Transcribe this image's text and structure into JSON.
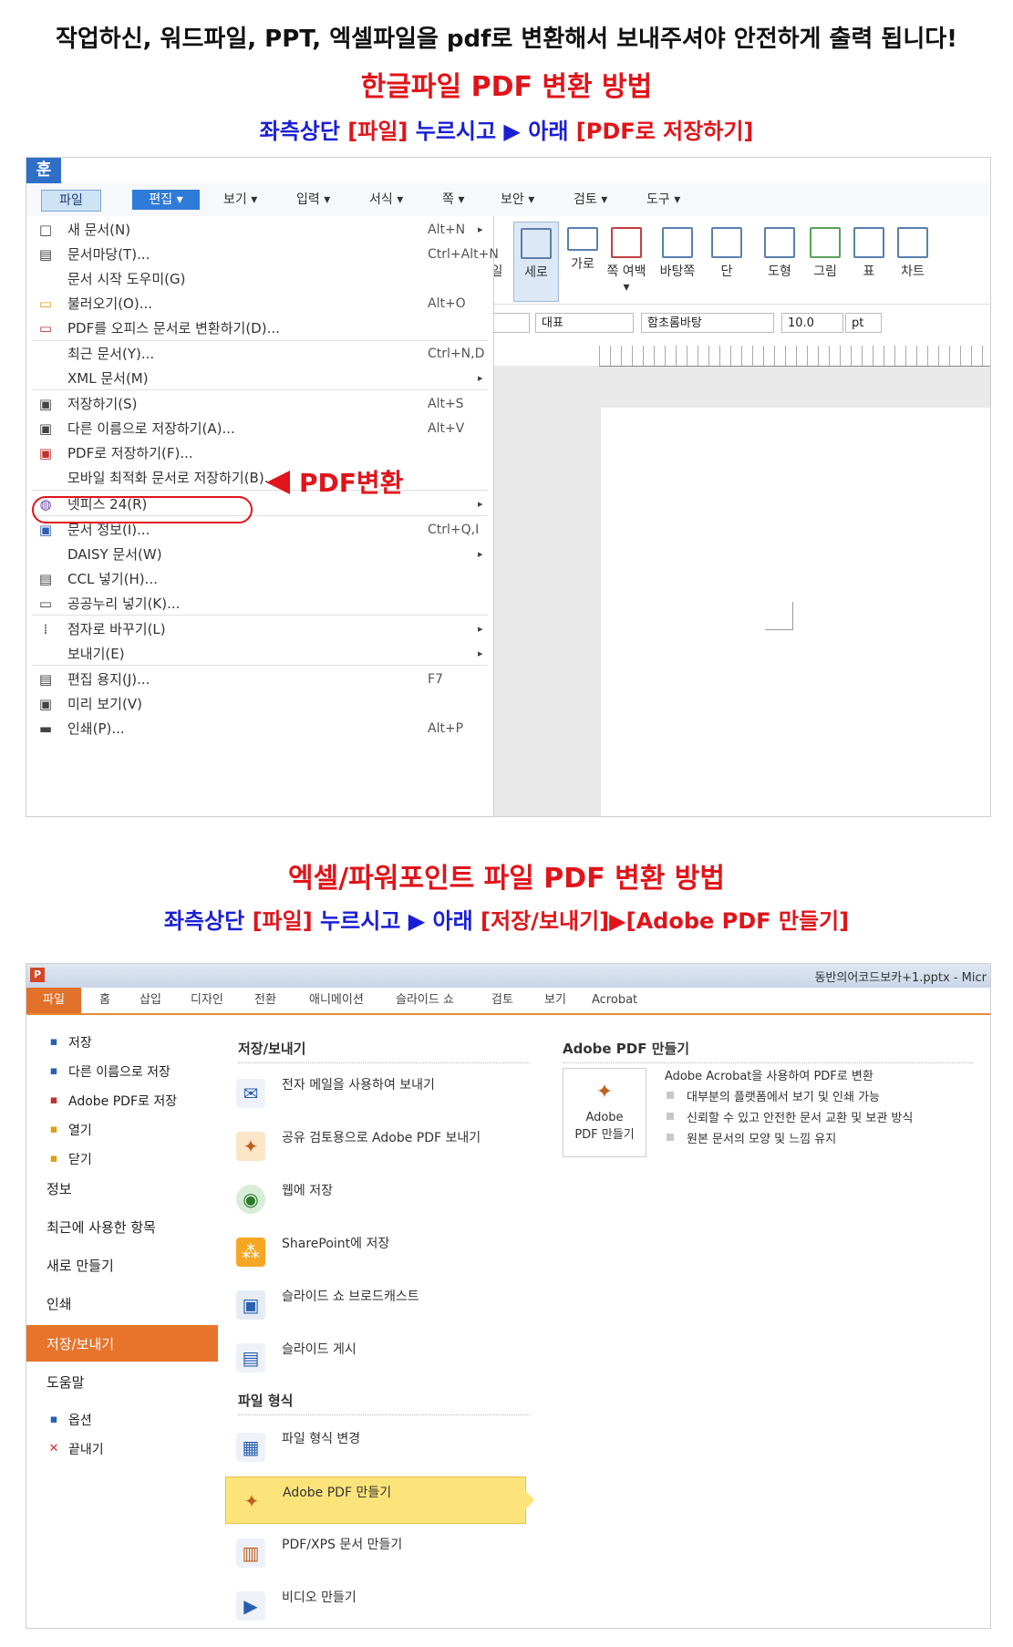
{
  "header": {
    "notice": "작업하신, 워드파일, PPT, 엑셀파일을 pdf로 변환해서 보내주셔야 안전하게 출력 됩니다!",
    "hwp_title": "한글파일 PDF 변환 방법",
    "hwp_instruction_a": "좌측상단 ",
    "hwp_instruction_b": "[파일]",
    "hwp_instruction_c": " 누르시고 ▶ 아래 ",
    "hwp_instruction_d": "[PDF로 저장하기]",
    "ppt_title": "엑셀/파워포인트 파일 PDF 변환 방법",
    "ppt_instruction_a": "좌측상단 ",
    "ppt_instruction_b": "[파일]",
    "ppt_instruction_c": " 누르시고 ▶ 아래 ",
    "ppt_instruction_d": "[저장/보내기]▶[Adobe PDF 만들기]"
  },
  "hwp": {
    "logo": "훈",
    "menu_tabs": [
      "파일",
      "편집 ▾",
      "보기 ▾",
      "입력 ▾",
      "서식 ▾",
      "쪽 ▾",
      "보안 ▾",
      "검토 ▾",
      "도구 ▾"
    ],
    "file_menu": [
      {
        "icon": "□",
        "label": "새 문서(N)",
        "shortcut": "Alt+N",
        "arrow": "▸"
      },
      {
        "icon": "▤",
        "label": "문서마당(T)...",
        "shortcut": "Ctrl+Alt+N",
        "arrow": ""
      },
      {
        "icon": "",
        "label": "문서 시작 도우미(G)",
        "shortcut": "",
        "arrow": ""
      },
      {
        "icon": "▭",
        "label": "불러오기(O)...",
        "shortcut": "Alt+O",
        "arrow": ""
      },
      {
        "icon": "▭",
        "label": "PDF를 오피스 문서로 변환하기(D)...",
        "shortcut": "",
        "arrow": ""
      },
      {
        "icon": "",
        "label": "최근 문서(Y)...",
        "shortcut": "Ctrl+N,D",
        "arrow": ""
      },
      {
        "icon": "",
        "label": "XML 문서(M)",
        "shortcut": "",
        "arrow": "▸"
      },
      {
        "icon": "▣",
        "label": "저장하기(S)",
        "shortcut": "Alt+S",
        "arrow": ""
      },
      {
        "icon": "▣",
        "label": "다른 이름으로 저장하기(A)...",
        "shortcut": "Alt+V",
        "arrow": ""
      },
      {
        "icon": "▣",
        "label": "PDF로 저장하기(F)...",
        "shortcut": "",
        "arrow": ""
      },
      {
        "icon": "",
        "label": "모바일 최적화 문서로 저장하기(B)...",
        "shortcut": "",
        "arrow": ""
      },
      {
        "icon": "◍",
        "label": "넷피스 24(R)",
        "shortcut": "",
        "arrow": "▸"
      },
      {
        "icon": "▣",
        "label": "문서 정보(I)...",
        "shortcut": "Ctrl+Q,I",
        "arrow": ""
      },
      {
        "icon": "",
        "label": "DAISY 문서(W)",
        "shortcut": "",
        "arrow": "▸"
      },
      {
        "icon": "▤",
        "label": "CCL 넣기(H)...",
        "shortcut": "",
        "arrow": ""
      },
      {
        "icon": "▭",
        "label": "공공누리 넣기(K)...",
        "shortcut": "",
        "arrow": ""
      },
      {
        "icon": "⁞",
        "label": "점자로 바꾸기(L)",
        "shortcut": "",
        "arrow": "▸"
      },
      {
        "icon": "",
        "label": "보내기(E)",
        "shortcut": "",
        "arrow": "▸"
      },
      {
        "icon": "▤",
        "label": "편집 용지(J)...",
        "shortcut": "F7",
        "arrow": ""
      },
      {
        "icon": "▣",
        "label": "미리 보기(V)",
        "shortcut": "",
        "arrow": ""
      },
      {
        "icon": "▬",
        "label": "인쇄(P)...",
        "shortcut": "Alt+P",
        "arrow": ""
      }
    ],
    "ribbon": [
      "일",
      "세로",
      "가로",
      "쪽 여백▾",
      "바탕쪽",
      "단",
      "도형",
      "그림",
      "표",
      "차트"
    ],
    "style_combo": "대표",
    "font_combo": "함초롬바탕",
    "size_combo": "10.0",
    "unit_combo": "pt",
    "callout": "PDF변환"
  },
  "ppt": {
    "filename": "동반의어코드보카+1.pptx - Micr",
    "app_icon": "P",
    "tabs": [
      "파일",
      "홈",
      "삽입",
      "디자인",
      "전환",
      "애니메이션",
      "슬라이드 쇼",
      "검토",
      "보기",
      "Acrobat"
    ],
    "side_small_top": [
      "저장",
      "다른 이름으로 저장",
      "Adobe PDF로 저장",
      "열기",
      "닫기"
    ],
    "side_large": [
      "정보",
      "최근에 사용한 항목",
      "새로 만들기",
      "인쇄",
      "저장/보내기",
      "도움말"
    ],
    "side_small_bottom": [
      "옵션",
      "끝내기"
    ],
    "section_save_send": "저장/보내기",
    "save_send_options": [
      "전자 메일을 사용하여 보내기",
      "공유 검토용으로 Adobe PDF 보내기",
      "웹에 저장",
      "SharePoint에 저장",
      "슬라이드 쇼 브로드캐스트",
      "슬라이드 게시"
    ],
    "section_file_types": "파일 형식",
    "file_type_options": [
      "파일 형식 변경",
      "Adobe PDF 만들기",
      "PDF/XPS 문서 만들기",
      "비디오 만들기"
    ],
    "right_title": "Adobe PDF 만들기",
    "big_button": "Adobe PDF 만들기",
    "big_button_line1": "Adobe",
    "big_button_line2": "PDF 만들기",
    "desc_title": "Adobe Acrobat을 사용하여 PDF로 변환",
    "desc_bullets": [
      "대부분의 플랫폼에서 보기 및 인쇄 가능",
      "신뢰할 수 있고 안전한 문서 교환 및 보관 방식",
      "원본 문서의 모양 및 느낌 유지"
    ]
  }
}
